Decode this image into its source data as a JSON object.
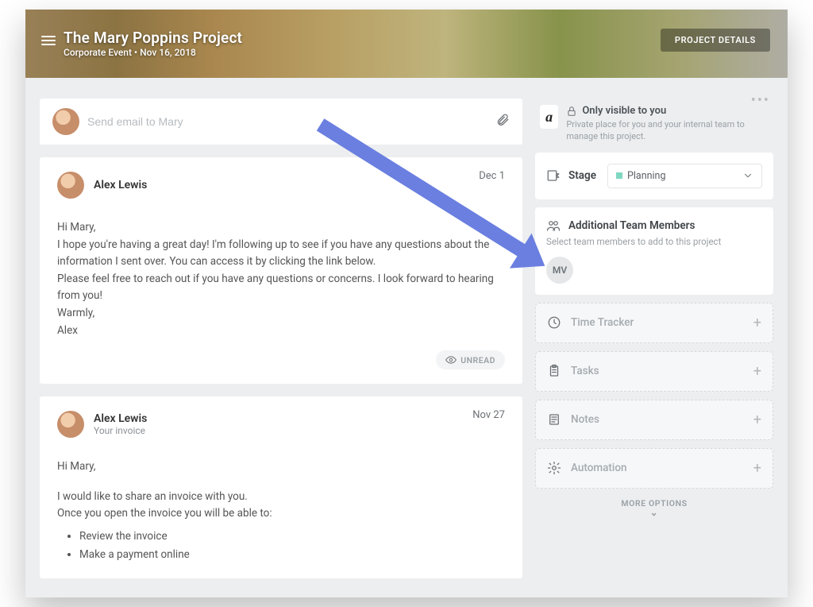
{
  "header": {
    "title": "The Mary Poppins Project",
    "subtitle": "Corporate Event  •  Nov 16, 2018",
    "project_details_label": "PROJECT DETAILS"
  },
  "compose": {
    "placeholder": "Send email to Mary"
  },
  "messages": [
    {
      "name": "Alex Lewis",
      "date": "Dec 1",
      "greeting": "Hi Mary,",
      "line1": "I hope you're having a great day! I'm following up to see if you have any questions about the information I sent over. You can access it by clicking the link below.",
      "line2": "Please feel free to reach out if you have any questions or concerns. I look forward to hearing from you!",
      "signoff1": "Warmly,",
      "signoff2": "Alex",
      "unread_label": "UNREAD"
    },
    {
      "name": "Alex Lewis",
      "subject": "Your invoice",
      "date": "Nov 27",
      "greeting": "Hi Mary,",
      "line1": "I would like to share an invoice with you.",
      "line2": "Once you open the invoice you will be able to:",
      "bullets": [
        "Review the invoice",
        "Make a payment online"
      ]
    }
  ],
  "sidepanel": {
    "visibility_title": "Only visible to you",
    "visibility_desc": "Private place for you and your internal team to manage this project.",
    "logo_text": "a",
    "stage_label": "Stage",
    "stage_value": "Planning",
    "team_title": "Additional Team Members",
    "team_desc": "Select team members to add to this project",
    "team_initials": "MV",
    "modules": {
      "time": "Time Tracker",
      "tasks": "Tasks",
      "notes": "Notes",
      "automation": "Automation"
    },
    "more_options": "MORE OPTIONS"
  }
}
